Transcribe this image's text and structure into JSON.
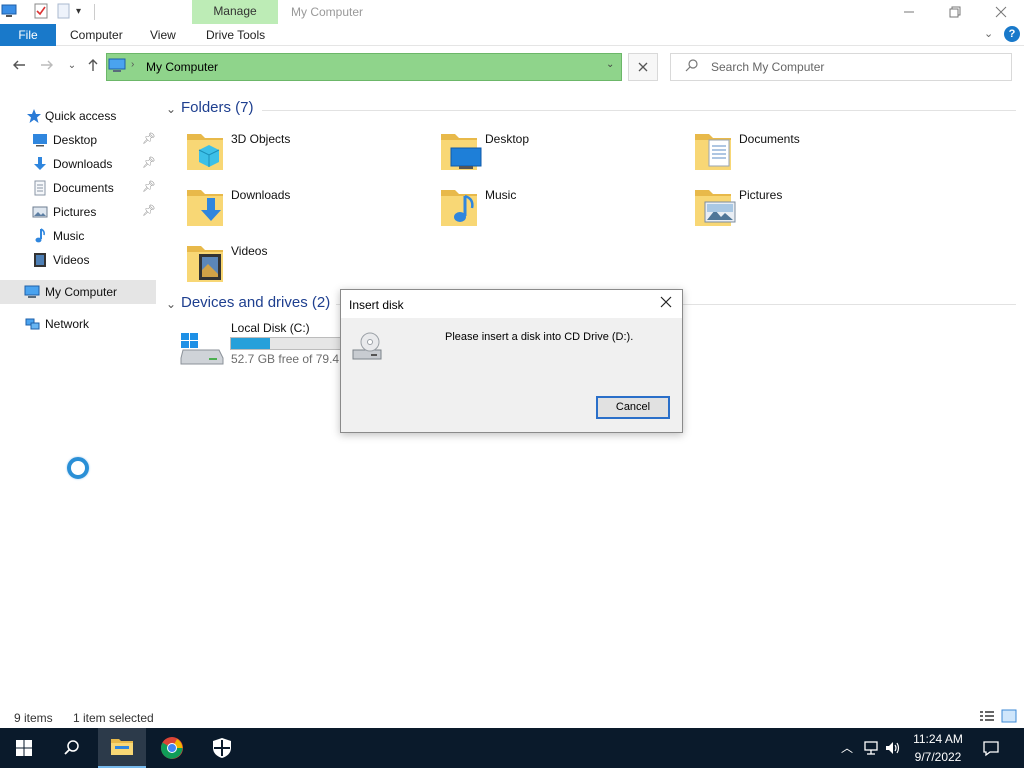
{
  "window": {
    "title": "My Computer",
    "contextual_tab": "Manage",
    "minimize_icon": "minimize-icon",
    "restore_icon": "restore-icon",
    "close_icon": "close-icon"
  },
  "ribbon": {
    "tabs": [
      {
        "label": "File",
        "active": true
      },
      {
        "label": "Computer"
      },
      {
        "label": "View"
      },
      {
        "label": "Drive Tools"
      }
    ],
    "help_label": "?"
  },
  "address": {
    "path": "My Computer",
    "search_placeholder": "Search My Computer"
  },
  "sidebar": {
    "quick_access": "Quick access",
    "items": [
      {
        "label": "Desktop",
        "icon": "desktop-icon",
        "pinned": true
      },
      {
        "label": "Downloads",
        "icon": "downloads-icon",
        "pinned": true
      },
      {
        "label": "Documents",
        "icon": "documents-icon",
        "pinned": true
      },
      {
        "label": "Pictures",
        "icon": "pictures-icon",
        "pinned": true
      },
      {
        "label": "Music",
        "icon": "music-icon"
      },
      {
        "label": "Videos",
        "icon": "videos-icon"
      }
    ],
    "my_computer": "My Computer",
    "network": "Network"
  },
  "folders": {
    "header": "Folders (7)",
    "items": [
      {
        "label": "3D Objects",
        "icon": "3d-objects-folder-icon"
      },
      {
        "label": "Desktop",
        "icon": "desktop-folder-icon"
      },
      {
        "label": "Documents",
        "icon": "documents-folder-icon"
      },
      {
        "label": "Downloads",
        "icon": "downloads-folder-icon"
      },
      {
        "label": "Music",
        "icon": "music-folder-icon"
      },
      {
        "label": "Pictures",
        "icon": "pictures-folder-icon"
      },
      {
        "label": "Videos",
        "icon": "videos-folder-icon"
      }
    ]
  },
  "devices": {
    "header": "Devices and drives (2)",
    "drive": {
      "label": "Local Disk (C:)",
      "free_text": "52.7 GB free of 79.4 G",
      "used_fraction": 0.34
    }
  },
  "dialog": {
    "title": "Insert disk",
    "message": "Please insert a disk into CD Drive (D:).",
    "cancel_label": "Cancel",
    "icon": "cd-drive-icon"
  },
  "status": {
    "items_count": "9 items",
    "selection": "1 item selected"
  },
  "taskbar": {
    "time": "11:24 AM",
    "date": "9/7/2022"
  },
  "colors": {
    "accent": "#1979ca",
    "address_bar": "#8fd48b",
    "manage_tab": "#bdecb6",
    "group_header": "#1e3f8f",
    "drive_fill": "#26a0da"
  }
}
